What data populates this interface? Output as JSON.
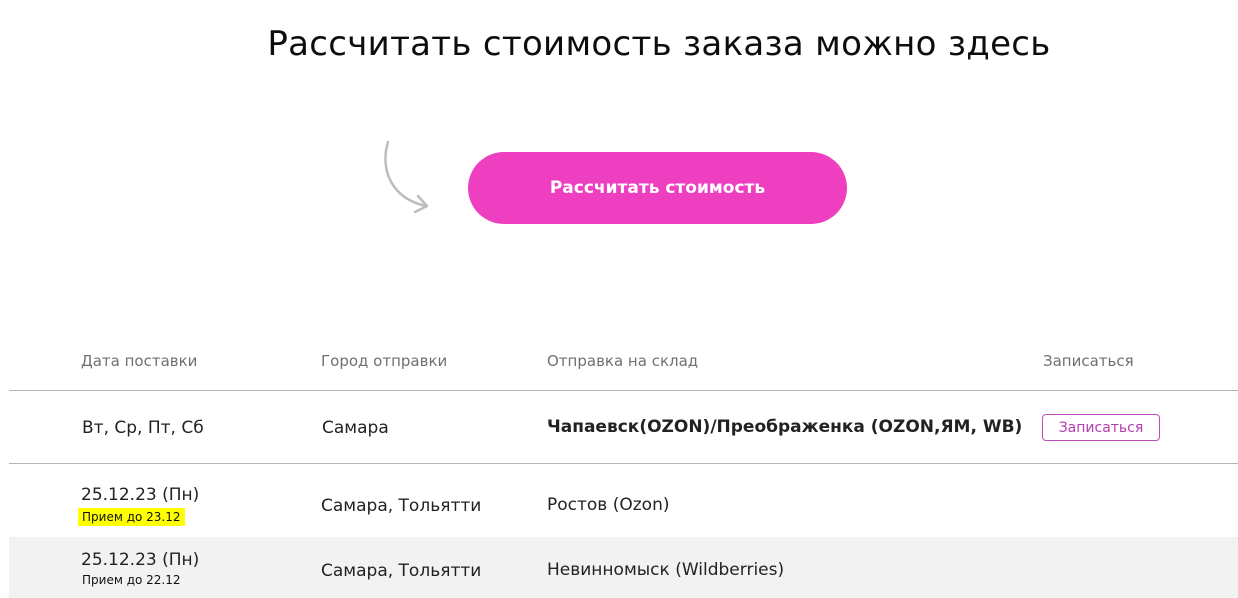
{
  "page": {
    "title": "Рассчитать стоимость заказа можно здесь",
    "cta_label": "Рассчитать стоимость"
  },
  "table": {
    "headers": [
      "Дата поставки",
      "Город отправки",
      "Отправка на склад",
      "Записаться"
    ],
    "rows": [
      {
        "date": "Вт, Ср, Пт, Сб",
        "city": "Самара",
        "warehouse": "Чапаевск(OZON)/Преображенка (OZON,ЯМ, WB)",
        "signup_label": "Записаться"
      },
      {
        "date": "25.12.23 (Пн)",
        "note": "Прием до 23.12",
        "city": "Самара, Тольятти",
        "warehouse": "Ростов (Ozon)"
      },
      {
        "date": "25.12.23 (Пн)",
        "note": "Прием до 22.12",
        "city": "Самара, Тольятти",
        "warehouse": "Невинномыск (Wildberries)"
      }
    ]
  },
  "colors": {
    "accent": "#ee3fc0",
    "signup_border": "#c14bbd",
    "highlight": "#ffff00",
    "alt_row": "#f2f2f2"
  },
  "icons": [
    "curved-arrow-icon"
  ]
}
